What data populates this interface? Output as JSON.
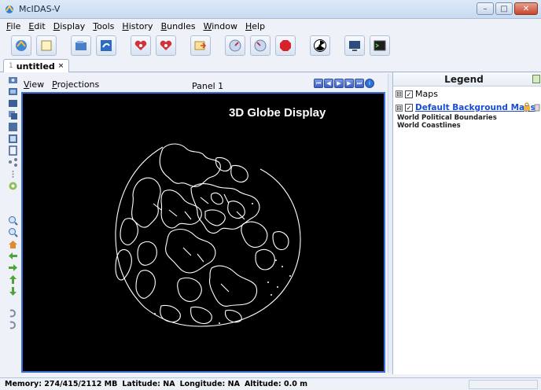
{
  "window": {
    "title": "McIDAS-V"
  },
  "menubar": {
    "items": [
      "File",
      "Edit",
      "Display",
      "Tools",
      "History",
      "Bundles",
      "Window",
      "Help"
    ]
  },
  "toolbar": {
    "buttons": [
      "new-display-icon",
      "data-sources-icon",
      "open-bundle-icon",
      "save-bundle-icon",
      "favorite-heart-icon",
      "favorite-heart-icon",
      "export-icon",
      "gauge-icon",
      "gauge-icon",
      "stop-icon",
      "radiation-icon",
      "monitor-icon",
      "console-icon"
    ]
  },
  "tabs": [
    {
      "index": "1",
      "label": "untitled",
      "close": "×"
    }
  ],
  "panel": {
    "menu": [
      "View",
      "Projections"
    ],
    "title": "Panel 1",
    "display_label": "3D Globe Display"
  },
  "legend": {
    "title": "Legend",
    "group": {
      "toggle": "⊟",
      "checked": "✓",
      "label": "Maps"
    },
    "layer": {
      "toggle": "⊟",
      "checked": "✓",
      "label": "Default Background Maps"
    },
    "sublayers": [
      "World Political Boundaries",
      "World Coastlines"
    ]
  },
  "status": {
    "memory": "Memory: 274/415/2112 MB",
    "latitude": "Latitude: NA",
    "longitude": "Longitude: NA",
    "altitude": "Altitude: 0.0 m"
  },
  "colors": {
    "accent": "#3a6fd8",
    "link": "#1a4bd0",
    "display_bg": "#000000"
  }
}
